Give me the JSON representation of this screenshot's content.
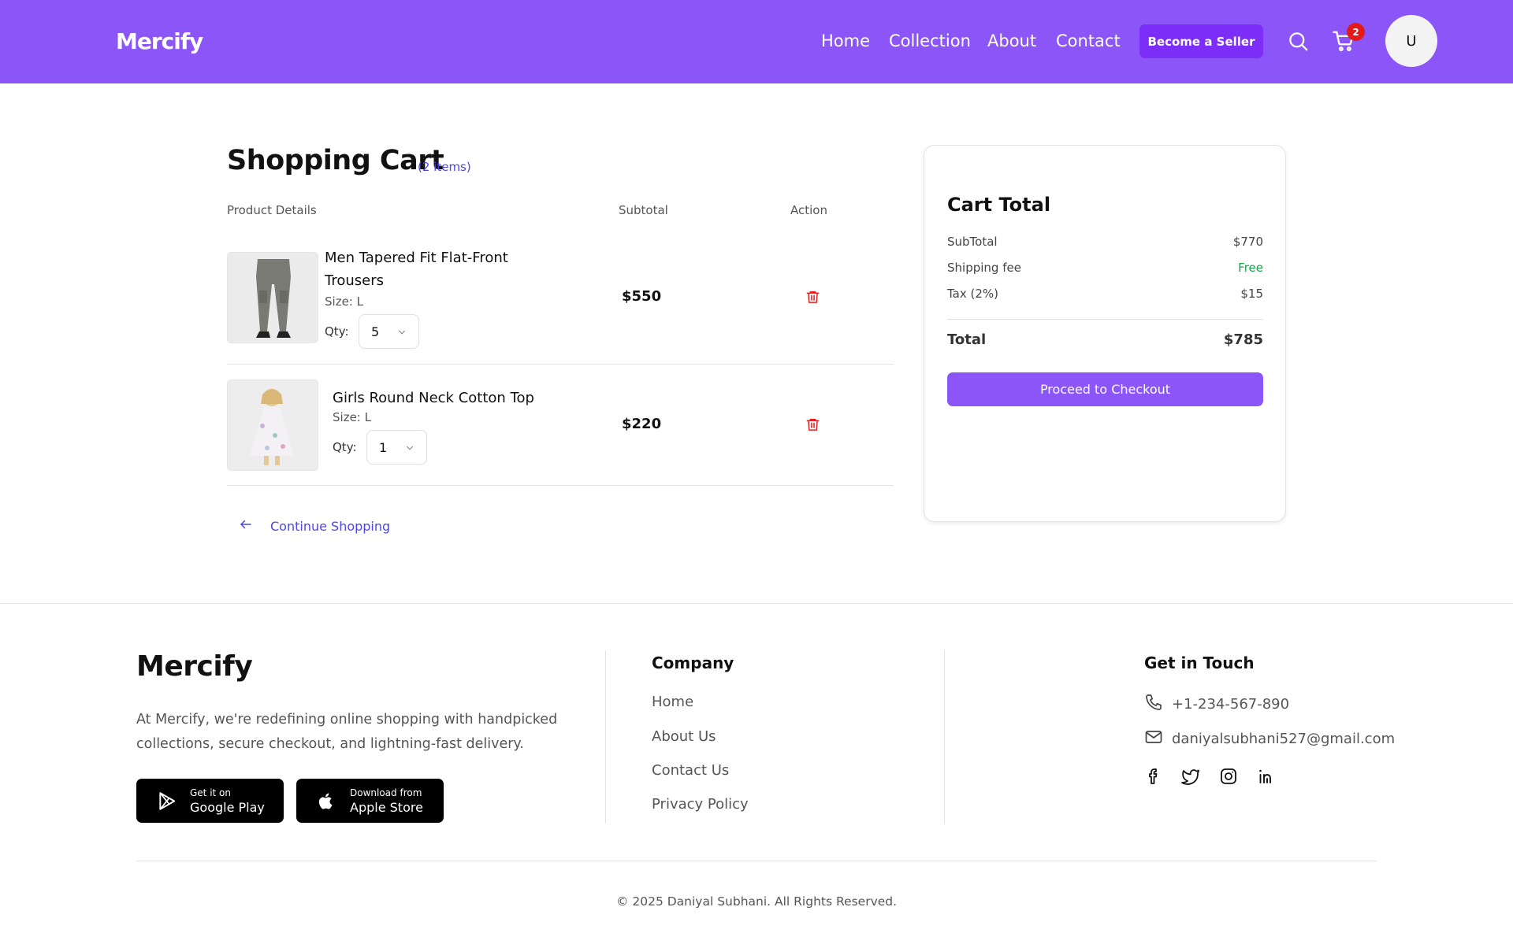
{
  "header": {
    "brand": "Mercify",
    "nav": [
      "Home",
      "Collection",
      "About",
      "Contact"
    ],
    "seller_button": "Become a Seller",
    "cart_count": "2",
    "avatar_initial": "U",
    "background_color": "#8b55f8",
    "accent_color": "#7c2df7"
  },
  "cart": {
    "title": "Shopping Cart",
    "count_label": "(2 items)",
    "columns": {
      "product": "Product Details",
      "subtotal": "Subtotal",
      "action": "Action"
    },
    "items": [
      {
        "name": "Men Tapered Fit Flat-Front Trousers",
        "size": "Size: L",
        "qty_label": "Qty:",
        "qty": "5",
        "price": "$550",
        "image": "trousers-photo"
      },
      {
        "name": "Girls Round Neck Cotton Top",
        "size": "Size: L",
        "qty_label": "Qty:",
        "qty": "1",
        "price": "$220",
        "image": "girls-top-photo"
      }
    ],
    "continue_label": "Continue Shopping",
    "link_color": "#4f46e5",
    "delete_color": "#dc2626"
  },
  "summary": {
    "title": "Cart Total",
    "rows": [
      {
        "label": "SubTotal",
        "value": "$770"
      },
      {
        "label": "Shipping fee",
        "value": "Free"
      },
      {
        "label": "Tax (2%)",
        "value": "$15"
      }
    ],
    "total_label": "Total",
    "total_value": "$785",
    "checkout_label": "Proceed to Checkout",
    "free_color": "#16a34a"
  },
  "footer": {
    "brand": "Mercify",
    "description": "At Mercify, we're redefining online shopping with handpicked collections, secure checkout, and lightning-fast delivery.",
    "google_play": {
      "small": "Get it on",
      "big": "Google Play"
    },
    "apple_store": {
      "small": "Download from",
      "big": "Apple Store"
    },
    "company_heading": "Company",
    "company_links": [
      "Home",
      "About Us",
      "Contact Us",
      "Privacy Policy"
    ],
    "contact_heading": "Get in Touch",
    "phone": "+1-234-567-890",
    "email": "daniyalsubhani527@gmail.com",
    "socials": [
      "facebook-icon",
      "twitter-icon",
      "instagram-icon",
      "linkedin-icon"
    ],
    "copyright": "© 2025 Daniyal Subhani. All Rights Reserved."
  }
}
